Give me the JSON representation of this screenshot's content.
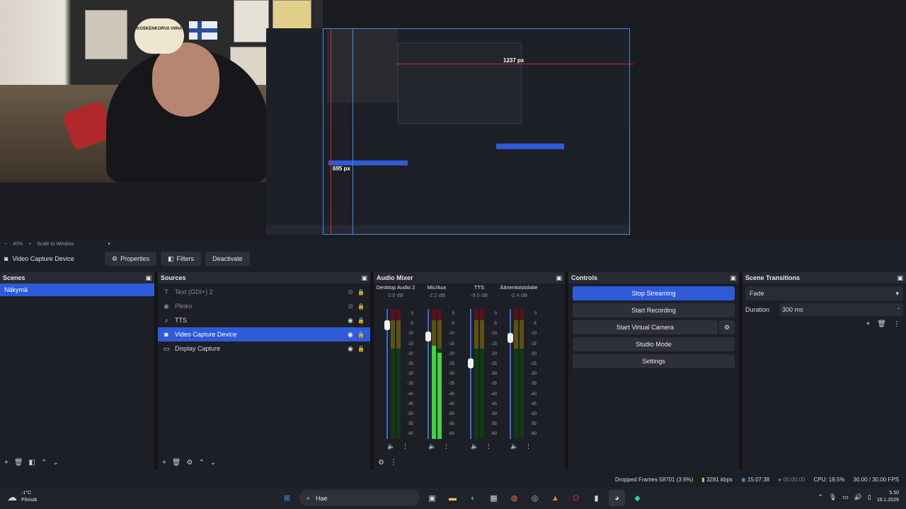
{
  "window": {
    "controls": [
      "—",
      "❐",
      "✕"
    ]
  },
  "preview": {
    "zoom": "40%",
    "scale_mode": "Scale to Window",
    "measure_h": "1237 px",
    "measure_v": "695 px",
    "sign_text": "KOSKENKORVA VIINA"
  },
  "source_toolbar": {
    "current_source": "Video Capture Device",
    "properties": "Properties",
    "filters": "Filters",
    "deactivate": "Deactivate"
  },
  "scenes": {
    "title": "Scenes",
    "items": [
      {
        "label": "Näkymä"
      }
    ]
  },
  "sources": {
    "title": "Sources",
    "items": [
      {
        "label": "Text (GDI+) 2"
      },
      {
        "label": "Plinko"
      },
      {
        "label": "TTS"
      },
      {
        "label": "Video Capture Device"
      },
      {
        "label": "Display Capture"
      }
    ]
  },
  "mixer": {
    "title": "Audio Mixer",
    "channels": [
      {
        "name": "Desktop Audio 2",
        "db": "0.0 dB",
        "level": 0.0
      },
      {
        "name": "Mic/Aux",
        "db": "-2.2 dB",
        "level": 0.72
      },
      {
        "name": "TTS",
        "db": "-9.5 dB",
        "level": 0.0
      },
      {
        "name": "Äänentoistolaite",
        "db": "-2.4 dB",
        "level": 0.0
      }
    ],
    "scale": [
      "0",
      "-5",
      "-10",
      "-15",
      "-20",
      "-25",
      "-30",
      "-35",
      "-40",
      "-45",
      "-50",
      "-55",
      "-60"
    ]
  },
  "controls": {
    "title": "Controls",
    "stop_streaming": "Stop Streaming",
    "start_recording": "Start Recording",
    "start_virtual_camera": "Start Virtual Camera",
    "studio_mode": "Studio Mode",
    "settings": "Settings"
  },
  "transitions": {
    "title": "Scene Transitions",
    "selected": "Fade",
    "duration_label": "Duration",
    "duration_value": "300 ms"
  },
  "status": {
    "dropped": "Dropped Frames 58701 (3.6%)",
    "bitrate": "3281 kbps",
    "stream_time": "15:07:38",
    "rec_time": "00:00:00",
    "cpu": "CPU: 18.5%",
    "fps": "30.00 / 30.00 FPS"
  },
  "taskbar": {
    "temp": "-1°C",
    "weather": "Pilvistä",
    "search": "Hae",
    "time": "5.50",
    "date": "16.1.2026"
  },
  "colors": {
    "accent": "#2f5ad8",
    "panel": "#1d1f26",
    "header": "#272a33"
  }
}
